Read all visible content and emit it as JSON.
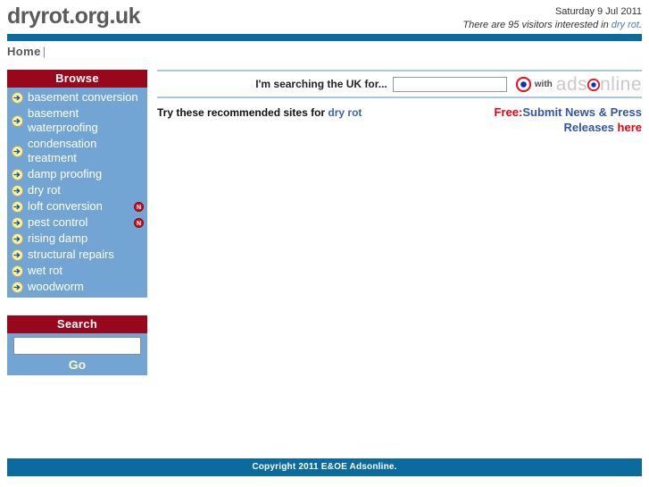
{
  "header": {
    "site_title": "dryrot.org.uk",
    "date": "Saturday 9 Jul 2011",
    "visitors_prefix": "There are 95 visitors interested in ",
    "visitors_link": "dry rot",
    "visitors_suffix": "."
  },
  "nav": {
    "home_label": "Home",
    "separator": "|"
  },
  "sidebar": {
    "browse": {
      "title": "Browse",
      "items": [
        {
          "label": "basement conversion",
          "icon": "arrow-right-icon",
          "badge": ""
        },
        {
          "label": "basement waterproofing",
          "icon": "arrow-right-icon",
          "badge": ""
        },
        {
          "label": "condensation treatment",
          "icon": "arrow-right-icon",
          "badge": ""
        },
        {
          "label": "damp proofing",
          "icon": "arrow-right-icon",
          "badge": ""
        },
        {
          "label": "dry rot",
          "icon": "arrow-right-icon",
          "badge": ""
        },
        {
          "label": "loft conversion",
          "icon": "arrow-right-icon",
          "badge": "N"
        },
        {
          "label": "pest control",
          "icon": "arrow-right-icon",
          "badge": "N"
        },
        {
          "label": "rising damp",
          "icon": "arrow-right-icon",
          "badge": ""
        },
        {
          "label": "structural repairs",
          "icon": "arrow-right-icon",
          "badge": ""
        },
        {
          "label": "wet rot",
          "icon": "arrow-right-icon",
          "badge": ""
        },
        {
          "label": "woodworm",
          "icon": "arrow-right-icon",
          "badge": ""
        }
      ]
    },
    "search": {
      "title": "Search",
      "input_value": "",
      "input_placeholder": "",
      "go_label": "Go"
    }
  },
  "main": {
    "uk_search": {
      "label": "I'm searching the UK for...",
      "input_value": "",
      "input_placeholder": "",
      "target_icon": "target-icon",
      "with_label": "with",
      "brand_part1": "ads",
      "brand_dot_icon": "target-dot-icon",
      "brand_part2": "nline"
    },
    "recommend": {
      "text": "Try these recommended sites for ",
      "link": "dry rot"
    },
    "promo": {
      "free_label": "Free:",
      "line1": "Submit News & Press",
      "line2": "Releases ",
      "here_label": "here"
    }
  },
  "footer": {
    "copyright": "Copyright 2011 E&OE Adsonline."
  },
  "colors": {
    "blue_bar": "#0b6a9e",
    "panel_header_red": "#99071c",
    "panel_body_blue": "#73a5d4",
    "promo_red": "#e8000d",
    "promo_blue": "#3355a8",
    "link_blue": "#3f63b5",
    "title_gray": "#5a5a5a"
  }
}
